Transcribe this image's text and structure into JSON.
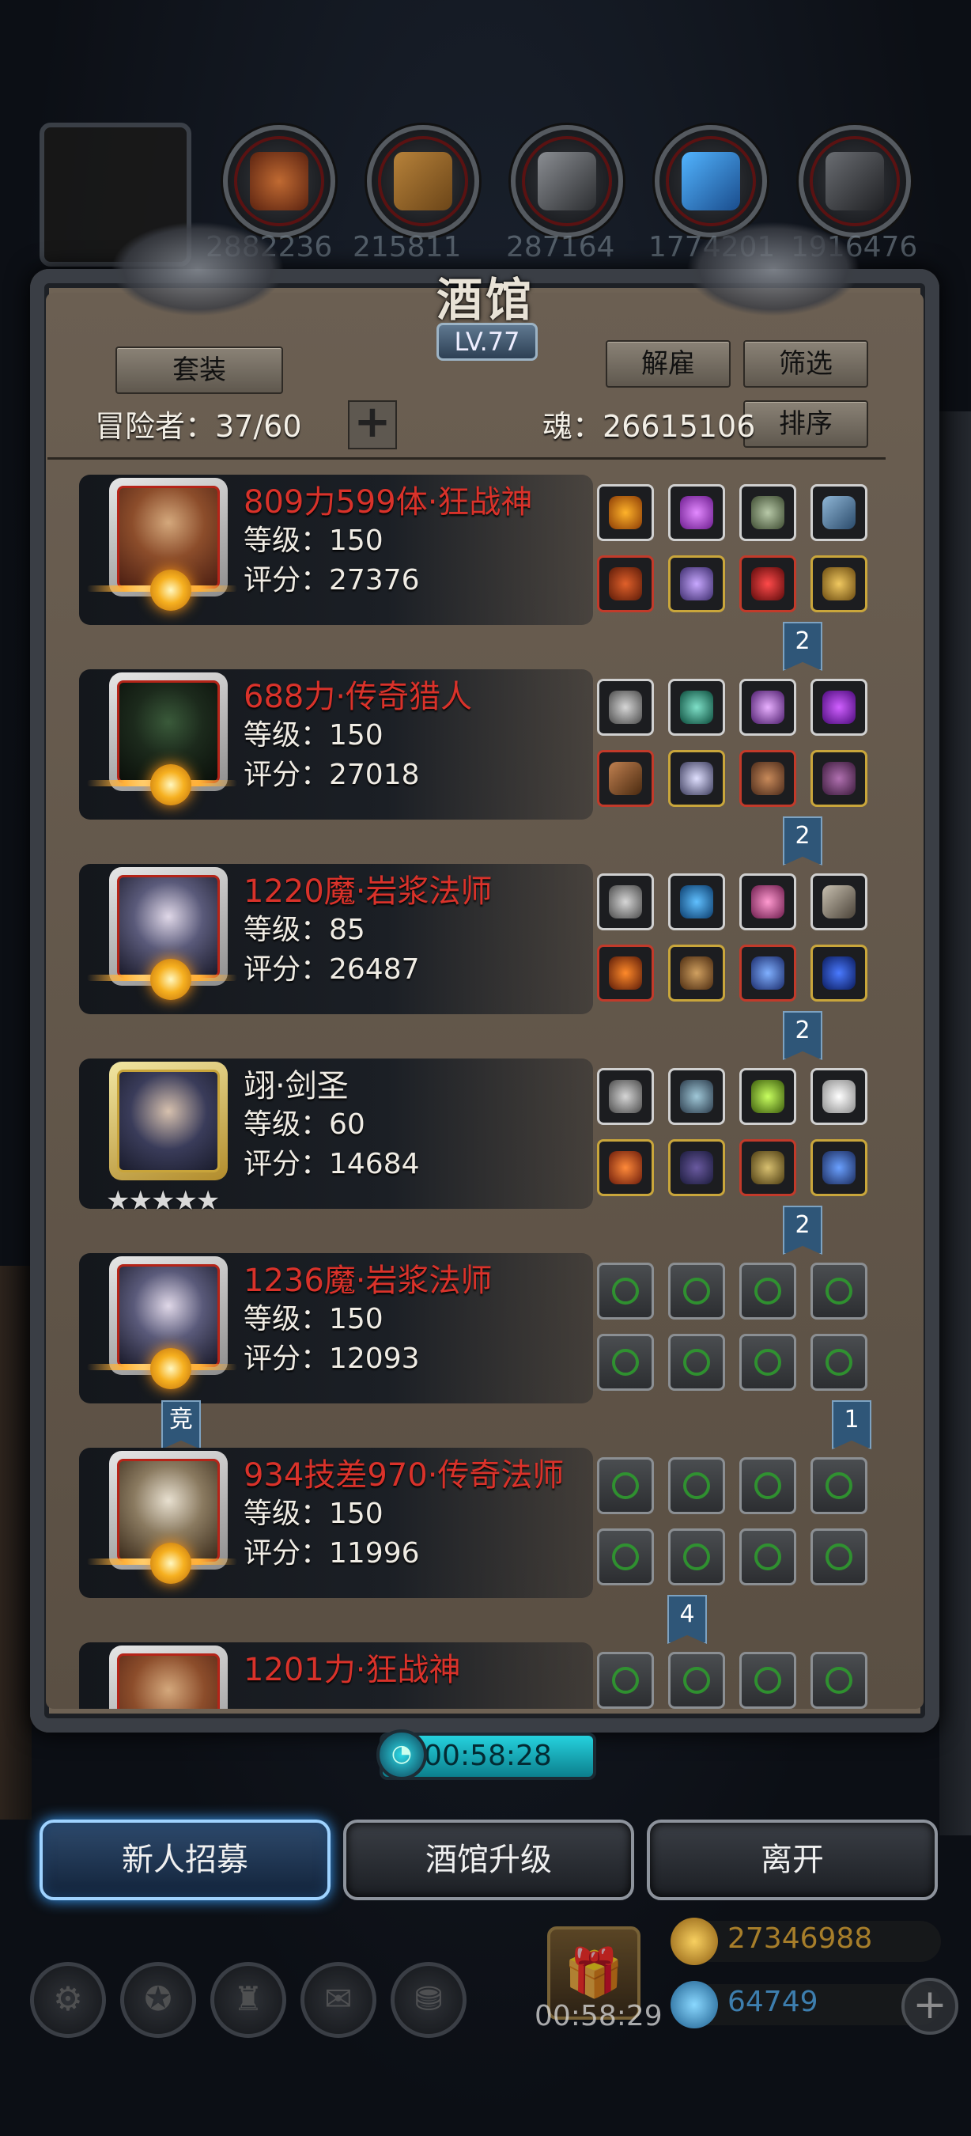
{
  "window": {
    "title": "酒馆",
    "level": "LV.77"
  },
  "top_bar": {
    "resource_values": [
      "2882236",
      "215811",
      "287164",
      "1774201",
      "1916476"
    ]
  },
  "toolbar": {
    "set_label": "套装",
    "dismiss_label": "解雇",
    "filter_label": "筛选",
    "sort_label": "排序",
    "adventurers_text": "冒险者：37/60",
    "add_label": "+",
    "soul_text": "魂：26615106"
  },
  "heroes": [
    {
      "name": "809力599体·狂战神",
      "level": "等级：150",
      "score": "评分：27376",
      "badge": "2",
      "tier": "red"
    },
    {
      "name": "688力·传奇猎人",
      "level": "等级：150",
      "score": "评分：27018",
      "badge": "2",
      "tier": "red"
    },
    {
      "name": "1220魔·岩浆法师",
      "level": "等级：85",
      "score": "评分：26487",
      "badge": "2",
      "tier": "red"
    },
    {
      "name": "翊·剑圣",
      "level": "等级：60",
      "score": "评分：14684",
      "badge": "2",
      "tier": "gold",
      "stars": "★★★★★"
    },
    {
      "name": "1236魔·岩浆法师",
      "level": "等级：150",
      "score": "评分：12093",
      "badge": "1",
      "tag": "竞",
      "tier": "red"
    },
    {
      "name": "934技差970·传奇法师",
      "level": "等级：150",
      "score": "评分：11996",
      "badge": "4",
      "tier": "red"
    },
    {
      "name": "1201力·狂战神",
      "level": "",
      "score": "",
      "badge": "",
      "tier": "red"
    }
  ],
  "timer": {
    "value": "00:58:28"
  },
  "bottom_buttons": {
    "recruit": "新人招募",
    "upgrade": "酒馆升级",
    "leave": "离开"
  },
  "hud": {
    "gold": "27346988",
    "gems": "64749",
    "gift_timer": "00:58:29"
  },
  "colors": {
    "hero_name_red": "#d9322a",
    "timer_cyan": "#25d2de",
    "active_button_glow": "#3aa0ff"
  }
}
